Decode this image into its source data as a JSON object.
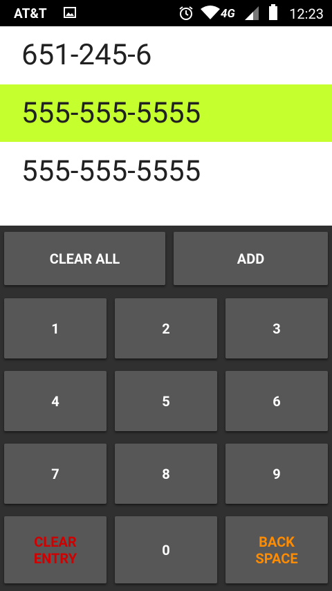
{
  "status_bar": {
    "carrier": "AT&T",
    "time": "12:23",
    "network": "4G",
    "icons": [
      "image-icon",
      "alarm-icon",
      "wifi-icon",
      "signal-icon",
      "battery-icon"
    ]
  },
  "numbers": {
    "entry": "651-245-6",
    "items": [
      "555-555-5555",
      "555-555-5555"
    ],
    "selected_index": 0,
    "selected_color": "#c6ff2e"
  },
  "keypad": {
    "clear_all": "CLEAR ALL",
    "add": "ADD",
    "digits": [
      "1",
      "2",
      "3",
      "4",
      "5",
      "6",
      "7",
      "8",
      "9",
      "0"
    ],
    "clear_entry": "CLEAR\nENTRY",
    "backspace": "BACK\nSPACE",
    "clear_entry_color": "#d10000",
    "backspace_color": "#ff8c00"
  }
}
